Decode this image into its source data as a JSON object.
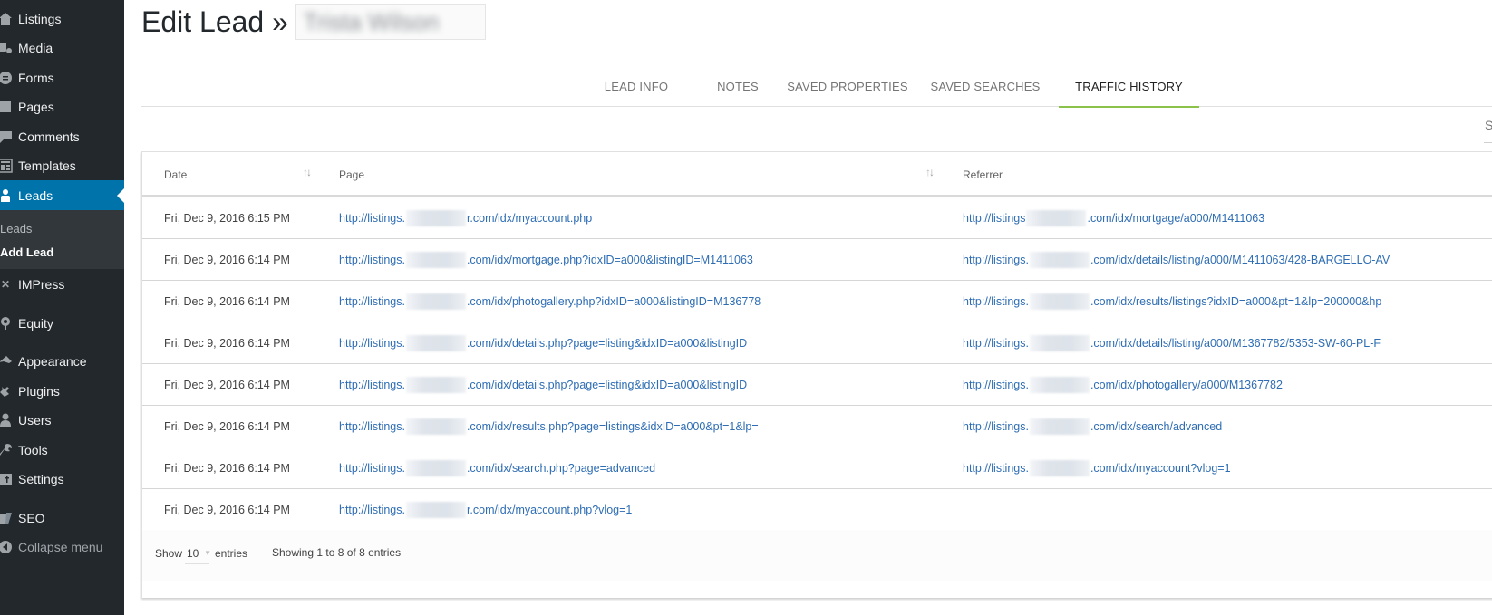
{
  "sidebar": {
    "items": [
      {
        "id": "listings",
        "label": "Listings",
        "icon": "home-icon"
      },
      {
        "id": "media",
        "label": "Media",
        "icon": "media-icon"
      },
      {
        "id": "forms",
        "label": "Forms",
        "icon": "forms-icon"
      },
      {
        "id": "pages",
        "label": "Pages",
        "icon": "pages-icon"
      },
      {
        "id": "comments",
        "label": "Comments",
        "icon": "comments-icon"
      },
      {
        "id": "templates",
        "label": "Templates",
        "icon": "templates-icon"
      },
      {
        "id": "leads",
        "label": "Leads",
        "icon": "leads-icon",
        "active": true
      },
      {
        "id": "impress",
        "label": "IMPress",
        "icon": "impress-icon"
      },
      {
        "id": "equity",
        "label": "Equity",
        "icon": "equity-icon"
      },
      {
        "id": "appearance",
        "label": "Appearance",
        "icon": "appearance-icon"
      },
      {
        "id": "plugins",
        "label": "Plugins",
        "icon": "plugins-icon"
      },
      {
        "id": "users",
        "label": "Users",
        "icon": "users-icon"
      },
      {
        "id": "tools",
        "label": "Tools",
        "icon": "tools-icon"
      },
      {
        "id": "settings",
        "label": "Settings",
        "icon": "settings-icon"
      },
      {
        "id": "seo",
        "label": "SEO",
        "icon": "seo-icon"
      },
      {
        "id": "collapse",
        "label": "Collapse menu",
        "icon": "collapse-icon"
      }
    ],
    "submenu": [
      {
        "label": "Leads"
      },
      {
        "label": "Add Lead",
        "current": true
      }
    ],
    "colors": {
      "background": "#23282d",
      "active": "#0073aa",
      "submenu": "#32373c"
    }
  },
  "header": {
    "title": "Edit Lead »",
    "lead_name": "Trista Wilson"
  },
  "tabs": [
    {
      "label": "LEAD INFO"
    },
    {
      "label": "NOTES"
    },
    {
      "label": "SAVED PROPERTIES"
    },
    {
      "label": "SAVED SEARCHES"
    },
    {
      "label": "TRAFFIC HISTORY",
      "active": true
    }
  ],
  "tab_accent_color": "#8bc34a",
  "search": {
    "label": "Se"
  },
  "table": {
    "columns": [
      "Date",
      "Page",
      "Referrer"
    ],
    "rows": [
      {
        "date": "Fri, Dec 9, 2016 6:15 PM",
        "page_prefix": "http://listings.",
        "page_suffix": "r.com/idx/myaccount.php",
        "ref_prefix": "http://listings",
        "ref_suffix": ".com/idx/mortgage/a000/M1411063"
      },
      {
        "date": "Fri, Dec 9, 2016 6:14 PM",
        "page_prefix": "http://listings.",
        "page_suffix": ".com/idx/mortgage.php?idxID=a000&listingID=M1411063",
        "ref_prefix": "http://listings.",
        "ref_suffix": ".com/idx/details/listing/a000/M1411063/428-BARGELLO-AV"
      },
      {
        "date": "Fri, Dec 9, 2016 6:14 PM",
        "page_prefix": "http://listings.",
        "page_suffix": ".com/idx/photogallery.php?idxID=a000&listingID=M136778",
        "ref_prefix": "http://listings.",
        "ref_suffix": ".com/idx/results/listings?idxID=a000&pt=1&lp=200000&hp"
      },
      {
        "date": "Fri, Dec 9, 2016 6:14 PM",
        "page_prefix": "http://listings.",
        "page_suffix": ".com/idx/details.php?page=listing&idxID=a000&listingID",
        "ref_prefix": "http://listings.",
        "ref_suffix": ".com/idx/details/listing/a000/M1367782/5353-SW-60-PL-F"
      },
      {
        "date": "Fri, Dec 9, 2016 6:14 PM",
        "page_prefix": "http://listings.",
        "page_suffix": ".com/idx/details.php?page=listing&idxID=a000&listingID",
        "ref_prefix": "http://listings.",
        "ref_suffix": ".com/idx/photogallery/a000/M1367782"
      },
      {
        "date": "Fri, Dec 9, 2016 6:14 PM",
        "page_prefix": "http://listings.",
        "page_suffix": ".com/idx/results.php?page=listings&idxID=a000&pt=1&lp=",
        "ref_prefix": "http://listings.",
        "ref_suffix": ".com/idx/search/advanced"
      },
      {
        "date": "Fri, Dec 9, 2016 6:14 PM",
        "page_prefix": "http://listings.",
        "page_suffix": ".com/idx/search.php?page=advanced",
        "ref_prefix": "http://listings.",
        "ref_suffix": ".com/idx/myaccount?vlog=1"
      },
      {
        "date": "Fri, Dec 9, 2016 6:14 PM",
        "page_prefix": "http://listings.",
        "page_suffix": "r.com/idx/myaccount.php?vlog=1",
        "ref_prefix": "",
        "ref_suffix": ""
      }
    ],
    "link_color": "#2e6db4"
  },
  "footer": {
    "show_label": "Show",
    "page_length": "10",
    "entries_label": "entries",
    "info": "Showing 1 to 8 of 8 entries"
  }
}
